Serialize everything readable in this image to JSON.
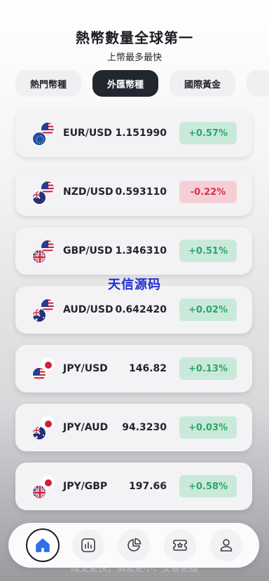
{
  "header": {
    "title": "熱幣數量全球第一",
    "subtitle": "上幣最多最快"
  },
  "tabs": [
    {
      "label": "熱門幣種",
      "active": false
    },
    {
      "label": "外匯幣種",
      "active": true
    },
    {
      "label": "國際黃金",
      "active": false
    },
    {
      "label": "",
      "active": false
    }
  ],
  "pairs": [
    {
      "pair": "EUR/USD",
      "price": "1.151990",
      "change": "+0.57%",
      "direction": "up",
      "flags": [
        "us-flag",
        "eu-flag"
      ]
    },
    {
      "pair": "NZD/USD",
      "price": "0.593110",
      "change": "-0.22%",
      "direction": "down",
      "flags": [
        "us-flag",
        "nz-flag"
      ]
    },
    {
      "pair": "GBP/USD",
      "price": "1.346310",
      "change": "+0.51%",
      "direction": "up",
      "flags": [
        "us-flag",
        "uk-flag"
      ]
    },
    {
      "pair": "AUD/USD",
      "price": "0.642420",
      "change": "+0.02%",
      "direction": "up",
      "flags": [
        "us-flag",
        "au-flag"
      ]
    },
    {
      "pair": "JPY/USD",
      "price": "146.82",
      "change": "+0.13%",
      "direction": "up",
      "flags": [
        "jp-flag",
        "us-flag"
      ]
    },
    {
      "pair": "JPY/AUD",
      "price": "94.3230",
      "change": "+0.03%",
      "direction": "up",
      "flags": [
        "jp-flag",
        "au-flag"
      ]
    },
    {
      "pair": "JPY/GBP",
      "price": "197.66",
      "change": "+0.58%",
      "direction": "up",
      "flags": [
        "jp-flag",
        "uk-flag"
      ]
    }
  ],
  "watermark": "天信源码",
  "footer_text": "成交更快，價差更小，交易更穩",
  "nav": [
    {
      "icon": "home-icon",
      "active": true
    },
    {
      "icon": "chart-icon",
      "active": false
    },
    {
      "icon": "pie-chart-icon",
      "active": false
    },
    {
      "icon": "ticket-icon",
      "active": false
    },
    {
      "icon": "user-icon",
      "active": false
    }
  ],
  "colors": {
    "up_text": "#2da56a",
    "up_bg": "#c9eadb",
    "down_text": "#d9314a",
    "down_bg": "#f5cfd6",
    "active_tab": "#22262f",
    "home_icon": "#2f6fe8"
  }
}
